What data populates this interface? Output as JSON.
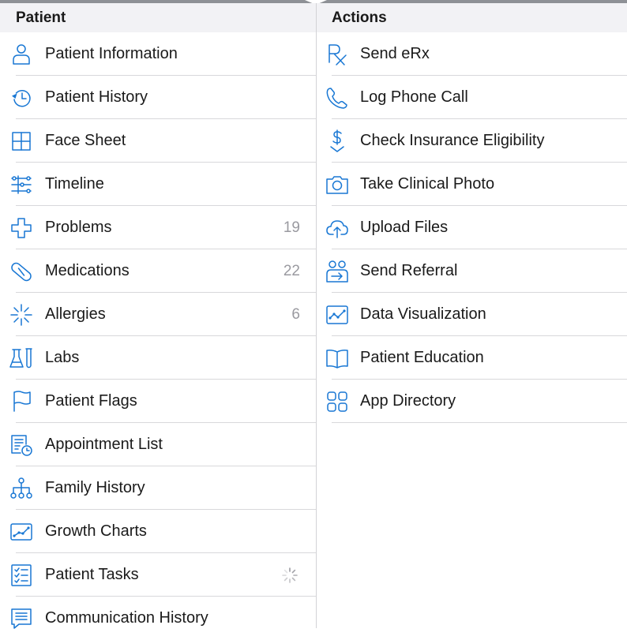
{
  "patient_section": {
    "header": "Patient",
    "items": [
      {
        "label": "Patient Information",
        "icon": "person-icon"
      },
      {
        "label": "Patient History",
        "icon": "history-clock-icon"
      },
      {
        "label": "Face Sheet",
        "icon": "grid-icon"
      },
      {
        "label": "Timeline",
        "icon": "timeline-icon"
      },
      {
        "label": "Problems",
        "icon": "medical-cross-icon",
        "count": "19"
      },
      {
        "label": "Medications",
        "icon": "pill-icon",
        "count": "22"
      },
      {
        "label": "Allergies",
        "icon": "allergy-burst-icon",
        "count": "6"
      },
      {
        "label": "Labs",
        "icon": "lab-beaker-icon"
      },
      {
        "label": "Patient Flags",
        "icon": "flag-icon"
      },
      {
        "label": "Appointment List",
        "icon": "appointment-list-icon"
      },
      {
        "label": "Family History",
        "icon": "family-tree-icon"
      },
      {
        "label": "Growth Charts",
        "icon": "growth-chart-icon"
      },
      {
        "label": "Patient Tasks",
        "icon": "checklist-icon",
        "loading": true
      },
      {
        "label": "Communication History",
        "icon": "message-icon"
      }
    ]
  },
  "actions_section": {
    "header": "Actions",
    "items": [
      {
        "label": "Send eRx",
        "icon": "rx-icon"
      },
      {
        "label": "Log Phone Call",
        "icon": "phone-icon"
      },
      {
        "label": "Check Insurance Eligibility",
        "icon": "dollar-check-icon"
      },
      {
        "label": "Take Clinical Photo",
        "icon": "camera-icon"
      },
      {
        "label": "Upload Files",
        "icon": "cloud-upload-icon"
      },
      {
        "label": "Send Referral",
        "icon": "referral-icon"
      },
      {
        "label": "Data Visualization",
        "icon": "data-chart-icon"
      },
      {
        "label": "Patient Education",
        "icon": "book-icon"
      },
      {
        "label": "App Directory",
        "icon": "app-grid-icon"
      }
    ]
  },
  "colors": {
    "accent": "#1877d4",
    "header_background": "#f2f2f5",
    "separator": "#d8d8db",
    "count_text": "#9a9aa0"
  }
}
